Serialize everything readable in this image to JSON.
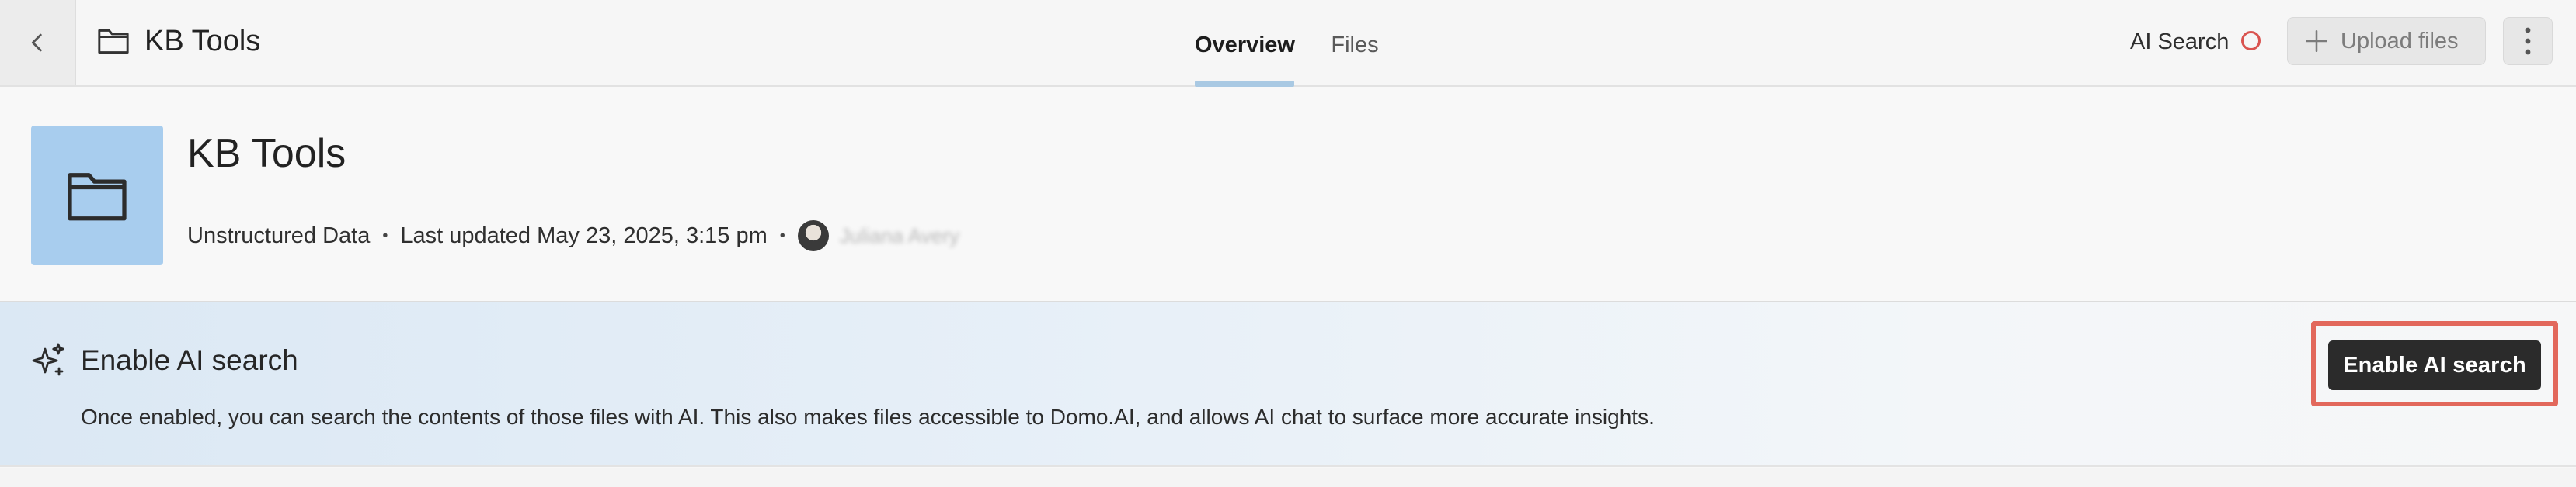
{
  "header": {
    "title": "KB Tools",
    "tabs": [
      {
        "label": "Overview",
        "active": true
      },
      {
        "label": "Files",
        "active": false
      }
    ],
    "ai_search_label": "AI Search",
    "ai_search_status_color": "#d9534f",
    "upload_label": "Upload files",
    "icons": {
      "back": "chevron-left-icon",
      "folder": "folder-icon",
      "upload": "plus-icon",
      "more": "more-vertical-icon"
    }
  },
  "info": {
    "title": "KB Tools",
    "type": "Unstructured Data",
    "last_updated": "Last updated May 23, 2025, 3:15 pm",
    "separator": "•",
    "owner_name": "Juliana Avery",
    "folder_tile_color": "#a8cdee"
  },
  "ai_banner": {
    "title": "Enable AI search",
    "description": "Once enabled, you can search the contents of those files with AI. This also makes files accessible to Domo.AI, and allows AI chat to surface more accurate insights.",
    "button_label": "Enable AI search",
    "highlight_color": "#e2685c",
    "icon": "sparkle-icon"
  }
}
